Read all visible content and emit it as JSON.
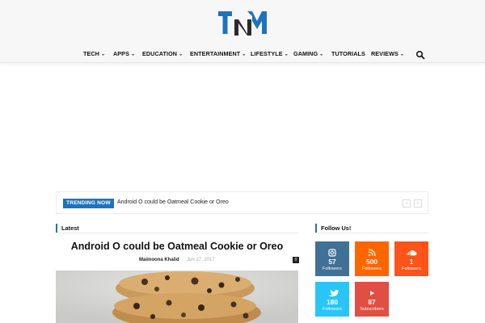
{
  "brand": {
    "logo_text": "TNM",
    "accent": "#1e73be"
  },
  "nav": {
    "items": [
      {
        "label": "TECH",
        "dropdown": true
      },
      {
        "label": "APPS",
        "dropdown": true
      },
      {
        "label": "EDUCATION",
        "dropdown": true
      },
      {
        "label": "ENTERTAINMENT",
        "dropdown": true
      },
      {
        "label": "LIFESTYLE",
        "dropdown": true
      },
      {
        "label": "GAMING",
        "dropdown": true
      },
      {
        "label": "TUTORIALS",
        "dropdown": false
      },
      {
        "label": "REVIEWS",
        "dropdown": true
      }
    ],
    "search_icon": "search-icon"
  },
  "trending": {
    "badge": "TRENDING NOW",
    "title": "Android O could be Oatmeal Cookie or Oreo",
    "prev_icon": "chevron-left-icon",
    "next_icon": "chevron-right-icon"
  },
  "latest": {
    "heading": "Latest",
    "article": {
      "title": "Android O could be Oatmeal Cookie or Oreo",
      "author": "Maimoona Khalid",
      "date": "Jun 27, 2017",
      "comments": "0"
    }
  },
  "follow": {
    "heading": "Follow Us!",
    "networks": [
      {
        "icon": "instagram-icon",
        "count": "57",
        "label": "Followers",
        "color": "#417096"
      },
      {
        "icon": "rss-icon",
        "count": "500",
        "label": "Followers",
        "color": "#ff6600"
      },
      {
        "icon": "soundcloud-icon",
        "count": "1",
        "label": "Followers",
        "color": "#ff5419"
      },
      {
        "icon": "twitter-icon",
        "count": "180",
        "label": "Followers",
        "color": "#29c5f6"
      },
      {
        "icon": "youtube-icon",
        "count": "87",
        "label": "Subscribers",
        "color": "#e14e42"
      }
    ]
  }
}
